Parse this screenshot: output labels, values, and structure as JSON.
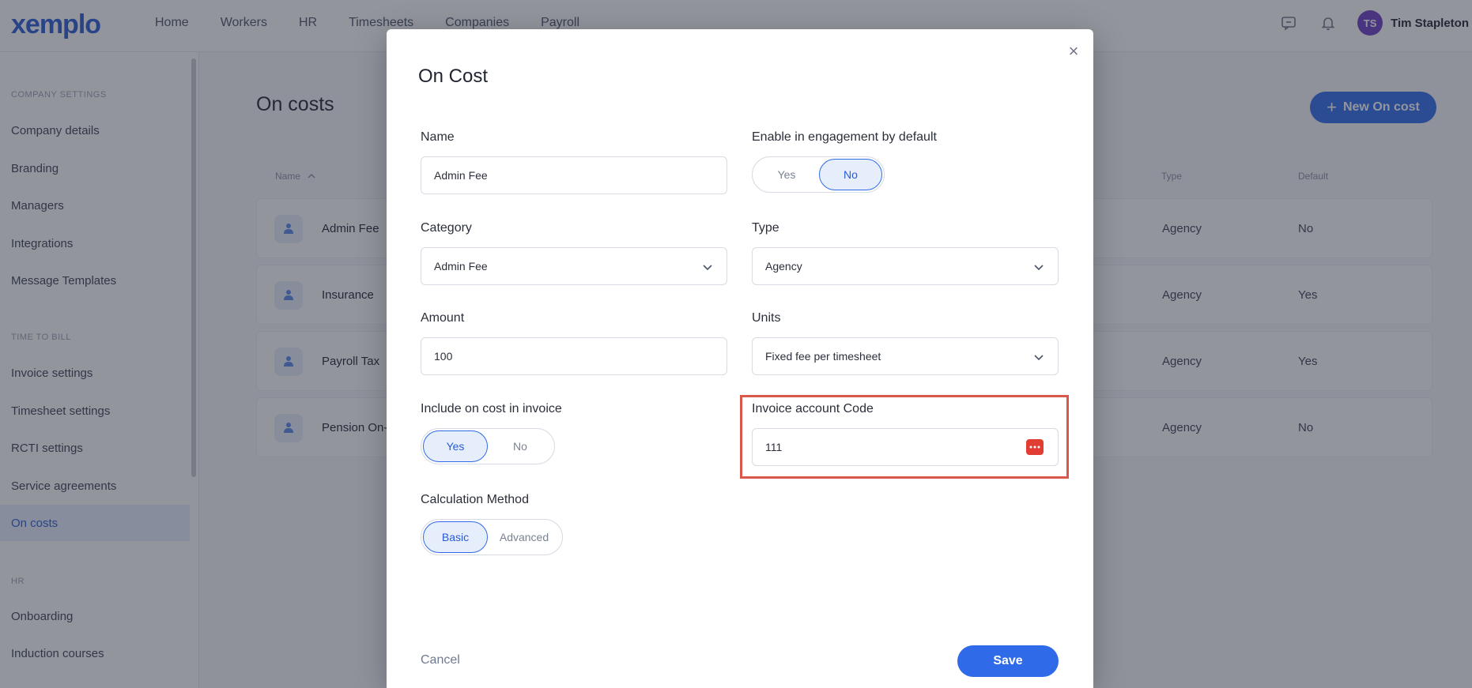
{
  "header": {
    "logo": "xemplo",
    "nav": [
      "Home",
      "Workers",
      "HR",
      "Timesheets",
      "Companies",
      "Payroll"
    ],
    "user_initials": "TS",
    "user_name": "Tim Stapleton"
  },
  "sidebar": {
    "sections": [
      {
        "heading": "COMPANY SETTINGS",
        "items": [
          "Company details",
          "Branding",
          "Managers",
          "Integrations",
          "Message Templates"
        ]
      },
      {
        "heading": "TIME TO BILL",
        "items": [
          "Invoice settings",
          "Timesheet settings",
          "RCTI settings",
          "Service agreements",
          "On costs"
        ]
      },
      {
        "heading": "HR",
        "items": [
          "Onboarding",
          "Induction courses"
        ]
      }
    ],
    "active_item": "On costs"
  },
  "main": {
    "title": "On costs",
    "new_button": "New On cost",
    "table": {
      "headers": {
        "name": "Name",
        "type": "Type",
        "default": "Default"
      },
      "rows": [
        {
          "name": "Admin Fee",
          "type": "Agency",
          "default": "No"
        },
        {
          "name": "Insurance",
          "type": "Agency",
          "default": "Yes"
        },
        {
          "name": "Payroll Tax",
          "type": "Agency",
          "default": "Yes"
        },
        {
          "name": "Pension On-",
          "type": "Agency",
          "default": "No"
        }
      ]
    }
  },
  "modal": {
    "title": "On Cost",
    "name_label": "Name",
    "name_value": "Admin Fee",
    "engagement_label": "Enable in engagement by default",
    "engagement_yes": "Yes",
    "engagement_no": "No",
    "category_label": "Category",
    "category_value": "Admin Fee",
    "type_label": "Type",
    "type_value": "Agency",
    "amount_label": "Amount",
    "amount_value": "100",
    "units_label": "Units",
    "units_value": "Fixed fee per timesheet",
    "include_label": "Include on cost in invoice",
    "include_yes": "Yes",
    "include_no": "No",
    "account_label": "Invoice account Code",
    "account_value": "111",
    "calc_label": "Calculation Method",
    "calc_basic": "Basic",
    "calc_advanced": "Advanced",
    "cancel": "Cancel",
    "save": "Save"
  },
  "colors": {
    "accent": "#2f6be8",
    "highlight": "#d9584b",
    "password_icon": "#e23d32"
  },
  "icons": [
    "chat-icon",
    "bell-icon",
    "sort-up-icon",
    "oncost-icon",
    "close-icon",
    "chevron-down-icon",
    "password-manager-icon",
    "plus-icon"
  ]
}
